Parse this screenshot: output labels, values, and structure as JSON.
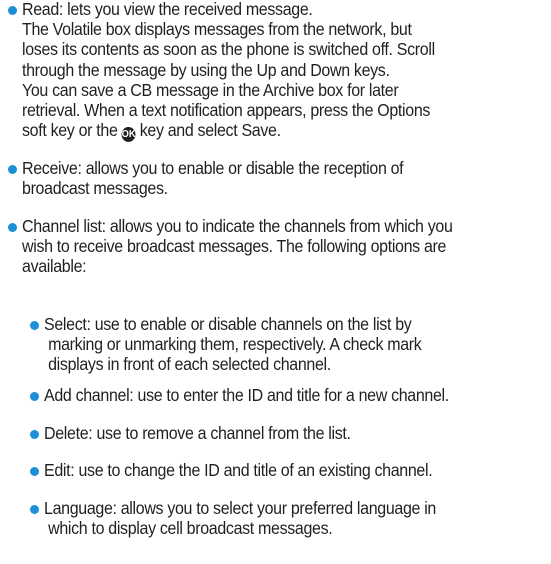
{
  "items": [
    {
      "lines": [
        "Read: lets you view the received message.",
        "The Volatile box displays messages from the network, but",
        "loses its contents as soon as the phone is switched off. Scroll",
        "through the message by using the Up and Down keys.",
        "You can save a CB message in the Archive box for later",
        "retrieval. When a text notification appears, press the Options"
      ],
      "last_before": "soft key or the",
      "key_icon": "ok-key-icon",
      "last_after": "key and select Save."
    },
    {
      "lines": [
        "Receive: allows you to enable or disable the reception of",
        "broadcast messages."
      ]
    },
    {
      "lines": [
        "Channel list: allows you to indicate the channels from which you",
        "wish to receive broadcast messages. The following options are",
        "available:"
      ]
    },
    {
      "lines": [
        "Select: use to enable or disable channels on the list by",
        " marking or unmarking them, respectively. A check mark",
        " displays in front of each selected channel."
      ]
    },
    {
      "lines": [
        "Add channel: use to enter the ID and title for a new channel."
      ]
    },
    {
      "lines": [
        "Delete: use to remove a channel from the list."
      ]
    },
    {
      "lines": [
        "Edit: use to change the ID and title of an existing channel."
      ]
    },
    {
      "lines": [
        "Language: allows you to select your preferred language in",
        " which to display cell broadcast messages."
      ]
    }
  ],
  "colors": {
    "bullet": "#1c8fd6",
    "text": "#231f20"
  }
}
